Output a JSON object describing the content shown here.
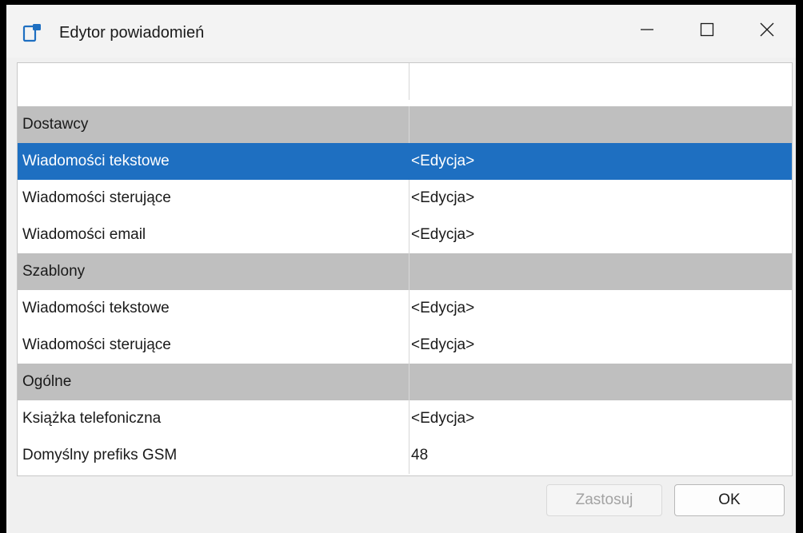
{
  "window": {
    "title": "Edytor powiadomień",
    "controls": {
      "minimize_icon": "minimize-icon",
      "maximize_icon": "maximize-icon",
      "close_icon": "close-icon"
    }
  },
  "grid": {
    "rows": [
      {
        "type": "header",
        "label": "",
        "value": ""
      },
      {
        "type": "category",
        "label": "Dostawcy",
        "value": ""
      },
      {
        "type": "item",
        "label": "Wiadomości tekstowe",
        "value": "<Edycja>",
        "selected": true
      },
      {
        "type": "item",
        "label": "Wiadomości sterujące",
        "value": "<Edycja>"
      },
      {
        "type": "item",
        "label": "Wiadomości email",
        "value": "<Edycja>"
      },
      {
        "type": "category",
        "label": "Szablony",
        "value": ""
      },
      {
        "type": "item",
        "label": "Wiadomości tekstowe",
        "value": "<Edycja>"
      },
      {
        "type": "item",
        "label": "Wiadomości sterujące",
        "value": "<Edycja>"
      },
      {
        "type": "category",
        "label": "Ogólne",
        "value": ""
      },
      {
        "type": "item",
        "label": "Książka telefoniczna",
        "value": "<Edycja>"
      },
      {
        "type": "item",
        "label": "Domyślny prefiks GSM",
        "value": "48"
      }
    ]
  },
  "buttons": {
    "apply_label": "Zastosuj",
    "apply_enabled": false,
    "ok_label": "OK"
  },
  "colors": {
    "selection": "#1e6fc1",
    "category_bg": "#bfbfbf",
    "app_icon": "#1e6fc1"
  }
}
